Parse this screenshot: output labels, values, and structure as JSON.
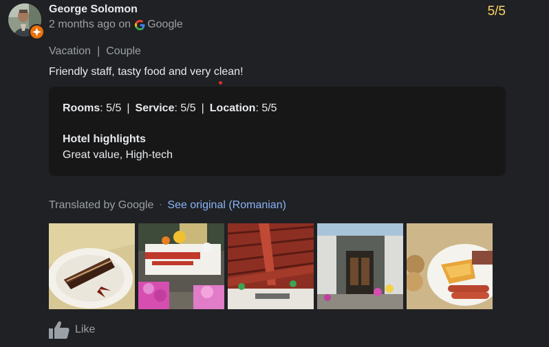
{
  "reviewer": {
    "name": "George Solomon",
    "time_ago": "2 months ago on",
    "source": "Google"
  },
  "rating": "5/5",
  "tags": [
    "Vacation",
    "Couple"
  ],
  "tag_separator": "|",
  "review_text": "Friendly staff, tasty food and very clean!",
  "details": {
    "ratings": [
      {
        "label": "Rooms",
        "value": ": 5/5"
      },
      {
        "label": "Service",
        "value": ": 5/5"
      },
      {
        "label": "Location",
        "value": ": 5/5"
      }
    ],
    "separator": "|",
    "highlights_title": "Hotel highlights",
    "highlights_value": "Great value, High-tech"
  },
  "translation": {
    "note": "Translated by Google",
    "dot": "·",
    "link": "See original (Romanian)"
  },
  "photos": [
    {
      "name": "photo-cake"
    },
    {
      "name": "photo-table-flowers"
    },
    {
      "name": "photo-wooden-roof"
    },
    {
      "name": "photo-entrance"
    },
    {
      "name": "photo-breakfast"
    }
  ],
  "like_label": "Like",
  "colors": {
    "background": "#202124",
    "card": "#171717",
    "rating": "#fdd663",
    "link": "#8ab4f8",
    "muted": "#9aa0a6",
    "badge": "#e8710a"
  },
  "icons": [
    "local-guide-badge-icon",
    "google-g-icon",
    "thumbs-up-icon"
  ]
}
